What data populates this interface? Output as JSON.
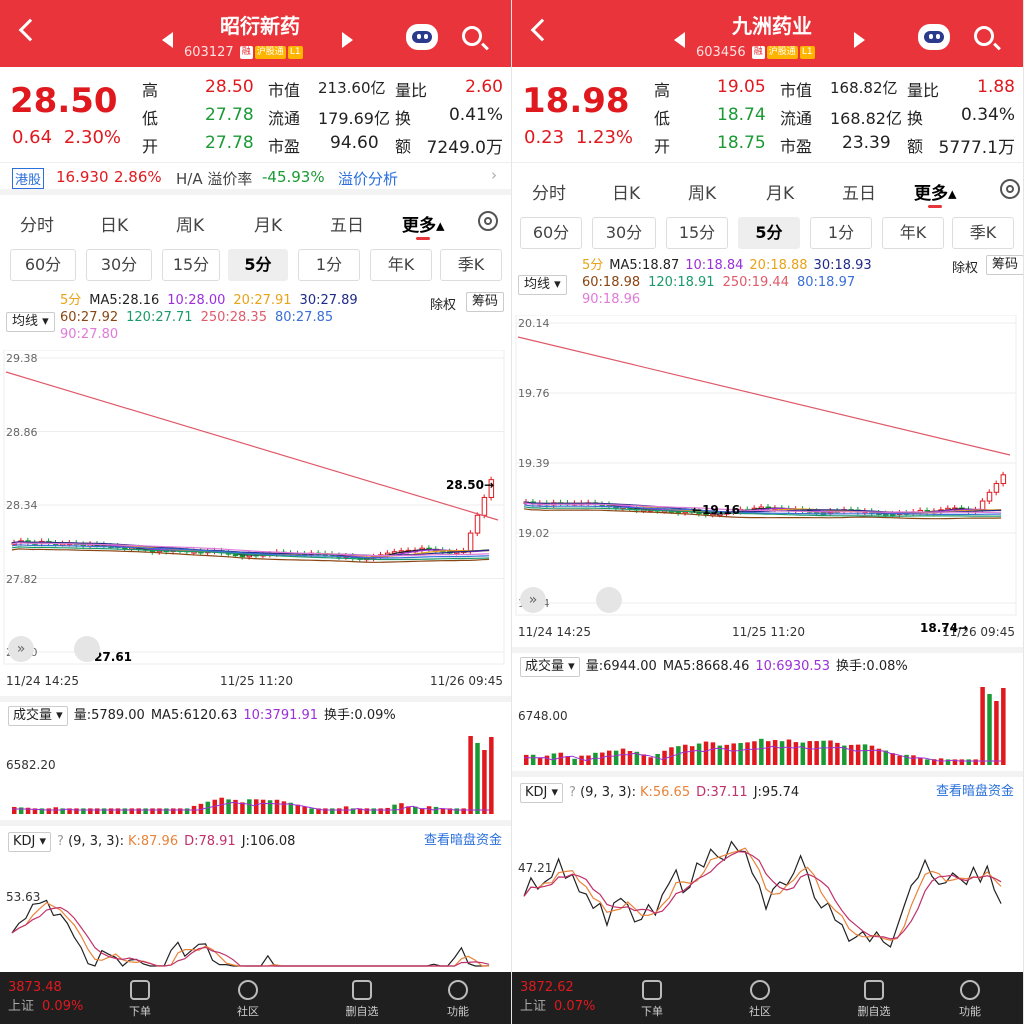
{
  "footer_tabs": [
    "下单",
    "社区",
    "删自选",
    "功能"
  ],
  "kline_tabs": [
    "60分",
    "30分",
    "15分",
    "5分",
    "1分",
    "年K",
    "季K"
  ],
  "ma_button": "均线",
  "exright": "除权",
  "chip": "筹码",
  "vol_button": "成交量",
  "kdj_button": "KDJ",
  "dark_pool": "查看暗盘资金",
  "panels": [
    {
      "name": "昭衍新药",
      "code": "603127",
      "badges": [
        "融",
        "沪股通",
        "L1"
      ],
      "price": "28.50",
      "change": "0.64",
      "pct": "2.30%",
      "high": "28.50",
      "low": "27.78",
      "open": "27.78",
      "mcap_label": "市值",
      "mcap": "213.60亿",
      "float_label": "流通",
      "float": "179.69亿",
      "pe_label": "市盈",
      "pe": "94.60",
      "ratio_label": "量比",
      "ratio": "2.60",
      "turnover_label": "换",
      "turnover": "0.41%",
      "amount_label": "额",
      "amount": "7249.0万",
      "hk": {
        "tag": "港股",
        "price": "16.930",
        "pct": "2.86%",
        "label": "H/A 溢价率",
        "premium": "-45.93%",
        "link": "溢价分析"
      },
      "period_tabs": [
        "分时",
        "日K",
        "周K",
        "月K",
        "五日",
        "更多"
      ],
      "ma": {
        "period": "5分",
        "ma5": "MA5:28.16",
        "ma10": "10:28.00",
        "ma20": "20:27.91",
        "ma30": "30:27.89",
        "ma60": "60:27.92",
        "ma120": "120:27.71",
        "ma250": "250:28.35",
        "ma80": "80:27.85",
        "ma90": "90:27.80"
      },
      "yticks": [
        "29.38",
        "28.86",
        "28.34",
        "27.82",
        "27.30"
      ],
      "xticks": [
        "11/24 14:25",
        "11/25 11:20",
        "11/26 09:45"
      ],
      "hi_mark": "28.50",
      "lo_mark": "27.61",
      "vol": {
        "v": "量:5789.00",
        "ma5": "MA5:6120.63",
        "ma10": "10:3791.91",
        "turn": "换手:0.09%",
        "ytick": "6582.20"
      },
      "kdj": {
        "param": "(9, 3, 3):",
        "k": "K:87.96",
        "d": "D:78.91",
        "j": "J:106.08",
        "ytick": "53.63"
      },
      "index": {
        "value": "3873.48",
        "name": "上证",
        "pct": "0.09%"
      }
    },
    {
      "name": "九洲药业",
      "code": "603456",
      "badges": [
        "融",
        "沪股通",
        "L1"
      ],
      "price": "18.98",
      "change": "0.23",
      "pct": "1.23%",
      "high": "19.05",
      "low": "18.74",
      "open": "18.75",
      "mcap_label": "市值",
      "mcap": "168.82亿",
      "float_label": "流通",
      "float": "168.82亿",
      "pe_label": "市盈",
      "pe": "23.39",
      "ratio_label": "量比",
      "ratio": "1.88",
      "turnover_label": "换",
      "turnover": "0.34%",
      "amount_label": "额",
      "amount": "5777.1万",
      "period_tabs": [
        "分时",
        "日K",
        "周K",
        "月K",
        "五日",
        "更多"
      ],
      "ma": {
        "period": "5分",
        "ma5": "MA5:18.87",
        "ma10": "10:18.84",
        "ma20": "20:18.88",
        "ma30": "30:18.93",
        "ma60": "60:18.98",
        "ma120": "120:18.91",
        "ma250": "250:19.44",
        "ma80": "80:18.97",
        "ma90": "90:18.96"
      },
      "yticks": [
        "20.14",
        "19.76",
        "19.39",
        "19.02",
        "18.64"
      ],
      "xticks": [
        "11/24 14:25",
        "11/25 11:20",
        "11/26 09:45"
      ],
      "hi_mark": "19.16",
      "lo_mark": "18.74",
      "vol": {
        "v": "量:6944.00",
        "ma5": "MA5:8668.46",
        "ma10": "10:6930.53",
        "turn": "换手:0.08%",
        "ytick": "6748.00"
      },
      "kdj": {
        "param": "(9, 3, 3):",
        "k": "K:56.65",
        "d": "D:37.11",
        "j": "J:95.74",
        "ytick": "47.21"
      },
      "index": {
        "value": "3872.62",
        "name": "上证",
        "pct": "0.07%"
      }
    }
  ],
  "colors": {
    "up": "#e0191f",
    "down": "#1a9a35",
    "header": "#e8343a",
    "ma5": "#222222",
    "ma10": "#9b30d9",
    "ma20": "#e8a317",
    "ma30": "#1f2a8a",
    "ma60": "#8b4513",
    "ma120": "#1a9a6b",
    "ma250": "#e05a6a",
    "ma80": "#3a6fd8",
    "ma90": "#e07ad8"
  }
}
